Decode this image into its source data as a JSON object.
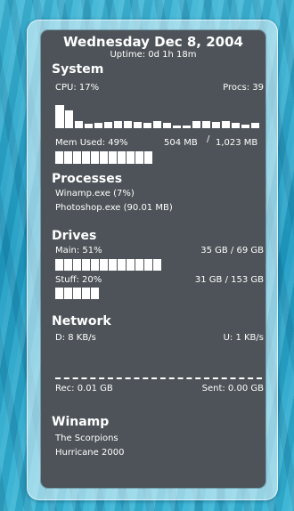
{
  "header": {
    "date": "Wednesday Dec 8, 2004",
    "uptime": "Uptime: 0d 1h 18m"
  },
  "system": {
    "title": "System",
    "cpu_label": "CPU: 17%",
    "procs_label": "Procs: 39",
    "cpu_percent": 17,
    "mem_label": "Mem Used: 49%",
    "mem_used": "504 MB",
    "mem_sep": "/",
    "mem_total": "1,023 MB",
    "mem_percent": 49
  },
  "processes": {
    "title": "Processes",
    "items": [
      "Winamp.exe (7%)",
      "Photoshop.exe (90.01 MB)"
    ]
  },
  "drives": {
    "title": "Drives",
    "items": [
      {
        "label": "Main: 51%",
        "value": "35 GB / 69 GB",
        "percent": 51
      },
      {
        "label": "Stuff: 20%",
        "value": "31 GB / 153 GB",
        "percent": 20
      }
    ]
  },
  "network": {
    "title": "Network",
    "down": "D: 8 KB/s",
    "up": "U: 1 KB/s",
    "received": "Rec: 0.01 GB",
    "sent": "Sent: 0.00 GB"
  },
  "winamp": {
    "title": "Winamp",
    "artist": "The Scorpions",
    "track": "Hurricane 2000"
  },
  "colors": {
    "panel": "#4d5358",
    "text": "#ffffff",
    "wallpaper": "#2aa6c9"
  }
}
